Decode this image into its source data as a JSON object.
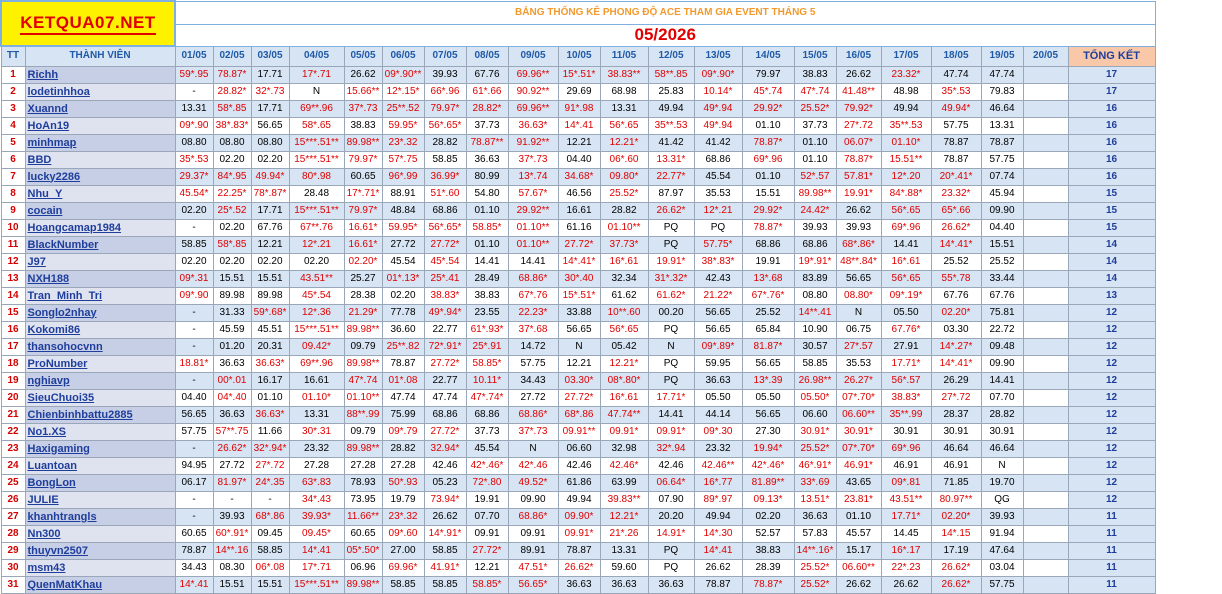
{
  "logo_text": "KETQUA07.NET",
  "title": "BẢNG THỐNG KÊ PHONG ĐỘ ACE THAM GIA EVENT THÁNG 5",
  "month": "05/2026",
  "headers": {
    "tt": "TT",
    "member": "THÀNH VIÊN",
    "total": "TỔNG KẾT",
    "dates": [
      "01/05",
      "02/05",
      "03/05",
      "04/05",
      "05/05",
      "06/05",
      "07/05",
      "08/05",
      "09/05",
      "10/05",
      "11/05",
      "12/05",
      "13/05",
      "14/05",
      "15/05",
      "16/05",
      "17/05",
      "18/05",
      "19/05",
      "20/05"
    ]
  },
  "colors": {
    "logo_bg": "#fff200",
    "red_text": "#e00000",
    "blue_text": "#1f3e9c",
    "row_tint": "#d6e4f3",
    "title_orange": "#f29a2e",
    "total_header_bg": "#f8c8a8"
  },
  "rows": [
    {
      "tt": "1",
      "name": "Richh",
      "total": "17",
      "cells": [
        "59*.95",
        "78.87*",
        "17.71",
        "17*.71",
        "26.62",
        "09*.90**",
        "39.93",
        "67.76",
        "69.96**",
        "15*.51*",
        "38.83**",
        "58**.85",
        "09*.90*",
        "79.97",
        "38.83",
        "26.62",
        "23.32*",
        "47.74",
        "47.74",
        ""
      ]
    },
    {
      "tt": "2",
      "name": "lodetinhhoa",
      "total": "17",
      "cells": [
        "-",
        "28.82*",
        "32*.73",
        "N",
        "15.66**",
        "12*.15*",
        "66*.96",
        "61*.66",
        "90.92**",
        "29.69",
        "68.98",
        "25.83",
        "10.14*",
        "45*.74",
        "47*.74",
        "41.48**",
        "48.98",
        "35*.53",
        "79.83",
        ""
      ]
    },
    {
      "tt": "3",
      "name": "Xuannd",
      "total": "16",
      "cells": [
        "13.31",
        "58*.85",
        "17.71",
        "69**.96",
        "37*.73",
        "25**.52",
        "79.97*",
        "28.82*",
        "69.96**",
        "91*.98",
        "13.31",
        "49.94",
        "49*.94",
        "29.92*",
        "25.52*",
        "79.92*",
        "49.94",
        "49.94*",
        "46.64",
        ""
      ]
    },
    {
      "tt": "4",
      "name": "HoAn19",
      "total": "16",
      "cells": [
        "09*.90",
        "38*.83*",
        "56.65",
        "58*.65",
        "38.83",
        "59.95*",
        "56*.65*",
        "37.73",
        "36.63*",
        "14*.41",
        "56*.65",
        "35**.53",
        "49*.94",
        "01.10",
        "37.73",
        "27*.72",
        "35**.53",
        "57.75",
        "13.31",
        ""
      ]
    },
    {
      "tt": "5",
      "name": "minhmap",
      "total": "16",
      "cells": [
        "08.80",
        "08.80",
        "08.80",
        "15***.51**",
        "89.98**",
        "23*.32",
        "28.82",
        "78.87**",
        "91.92**",
        "12.21",
        "12.21*",
        "41.42",
        "41.42",
        "78.87*",
        "01.10",
        "06.07*",
        "01.10*",
        "78.87",
        "78.87",
        ""
      ]
    },
    {
      "tt": "6",
      "name": "BBD",
      "total": "16",
      "cells": [
        "35*.53",
        "02.20",
        "02.20",
        "15***.51**",
        "79.97*",
        "57*.75",
        "58.85",
        "36.63",
        "37*.73",
        "04.40",
        "06*.60",
        "13.31*",
        "68.86",
        "69*.96",
        "01.10",
        "78.87*",
        "15.51**",
        "78.87",
        "57.75",
        ""
      ]
    },
    {
      "tt": "7",
      "name": "lucky2286",
      "total": "16",
      "cells": [
        "29.37*",
        "84*.95",
        "49.94*",
        "80*.98",
        "60.65",
        "96*.99",
        "36.99*",
        "80.99",
        "13*.74",
        "34.68*",
        "09.80*",
        "22.77*",
        "45.54",
        "01.10",
        "52*.57",
        "57.81*",
        "12*.20",
        "20*.41*",
        "07.74",
        ""
      ]
    },
    {
      "tt": "8",
      "name": "Nhu_Y",
      "total": "15",
      "cells": [
        "45.54*",
        "22.25*",
        "78*.87*",
        "28.48",
        "17*.71*",
        "88.91",
        "51*.60",
        "54.80",
        "57.67*",
        "46.56",
        "25.52*",
        "87.97",
        "35.53",
        "15.51",
        "89.98**",
        "19.91*",
        "84*.88*",
        "23.32*",
        "45.94",
        ""
      ]
    },
    {
      "tt": "9",
      "name": "cocain",
      "total": "15",
      "cells": [
        "02.20",
        "25*.52",
        "17.71",
        "15***.51**",
        "79.97*",
        "48.84",
        "68.86",
        "01.10",
        "29.92**",
        "16.61",
        "28.82",
        "26.62*",
        "12*.21",
        "29.92*",
        "24.42*",
        "26.62",
        "56*.65",
        "65*.66",
        "09.90",
        ""
      ]
    },
    {
      "tt": "10",
      "name": "Hoangcamap1984",
      "total": "15",
      "cells": [
        "-",
        "02.20",
        "67.76",
        "67**.76",
        "16.61*",
        "59.95*",
        "56*.65*",
        "58.85*",
        "01.10**",
        "61.16",
        "01.10**",
        "PQ",
        "PQ",
        "78.87*",
        "39.93",
        "39.93",
        "69*.96",
        "26.62*",
        "04.40",
        ""
      ]
    },
    {
      "tt": "11",
      "name": "BlackNumber",
      "total": "14",
      "cells": [
        "58.85",
        "58*.85",
        "12.21",
        "12*.21",
        "16.61*",
        "27.72",
        "27.72*",
        "01.10",
        "01.10**",
        "27.72*",
        "37.73*",
        "PQ",
        "57.75*",
        "68.86",
        "68.86",
        "68*.86*",
        "14.41",
        "14*.41*",
        "15.51",
        ""
      ]
    },
    {
      "tt": "12",
      "name": "J97",
      "total": "14",
      "cells": [
        "02.20",
        "02.20",
        "02.20",
        "02.20",
        "02.20*",
        "45.54",
        "45*.54",
        "14.41",
        "14.41",
        "14*.41*",
        "16*.61",
        "19.91*",
        "38*.83*",
        "19.91",
        "19*.91*",
        "48**.84*",
        "16*.61",
        "25.52",
        "25.52",
        ""
      ]
    },
    {
      "tt": "13",
      "name": "NXH188",
      "total": "14",
      "cells": [
        "09*.31",
        "15.51",
        "15.51",
        "43.51**",
        "25.27",
        "01*.13*",
        "25*.41",
        "28.49",
        "68.86*",
        "30*.40",
        "32.34",
        "31*.32*",
        "42.43",
        "13*.68",
        "83.89",
        "56.65",
        "56*.65",
        "55*.78",
        "33.44",
        ""
      ]
    },
    {
      "tt": "14",
      "name": "Tran_Minh_Tri",
      "total": "13",
      "cells": [
        "09*.90",
        "89.98",
        "89.98",
        "45*.54",
        "28.38",
        "02.20",
        "38.83*",
        "38.83",
        "67*.76",
        "15*.51*",
        "61.62",
        "61.62*",
        "21.22*",
        "67*.76*",
        "08.80",
        "08.80*",
        "09*.19*",
        "67.76",
        "67.76",
        ""
      ]
    },
    {
      "tt": "15",
      "name": "Songlo2nhay",
      "total": "12",
      "cells": [
        "-",
        "31.33",
        "59*.68*",
        "12*.36",
        "21.29*",
        "77.78",
        "49*.94*",
        "23.55",
        "22.23*",
        "33.88",
        "10**.60",
        "00.20",
        "56.65",
        "25.52",
        "14**.41",
        "N",
        "05.50",
        "02.20*",
        "75.81",
        ""
      ]
    },
    {
      "tt": "16",
      "name": "Kokomi86",
      "total": "12",
      "cells": [
        "-",
        "45.59",
        "45.51",
        "15***.51**",
        "89.98**",
        "36.60",
        "22.77",
        "61*.93*",
        "37*.68",
        "56.65",
        "56*.65",
        "PQ",
        "56.65",
        "65.84",
        "10.90",
        "06.75",
        "67.76*",
        "03.30",
        "22.72",
        ""
      ]
    },
    {
      "tt": "17",
      "name": "thansohocvnn",
      "total": "12",
      "cells": [
        "-",
        "01.20",
        "20.31",
        "09.42*",
        "09.79",
        "25**.82",
        "72*.91*",
        "25*.91",
        "14.72",
        "N",
        "05.42",
        "N",
        "09*.89*",
        "81.87*",
        "30.57",
        "27*.57",
        "27.91",
        "14*.27*",
        "09.48",
        ""
      ]
    },
    {
      "tt": "18",
      "name": "ProNumber",
      "total": "12",
      "cells": [
        "18.81*",
        "36.63",
        "36.63*",
        "69**.96",
        "89.98**",
        "78.87",
        "27.72*",
        "58.85*",
        "57.75",
        "12.21",
        "12.21*",
        "PQ",
        "59.95",
        "56.65",
        "58.85",
        "35.53",
        "17.71*",
        "14*.41*",
        "09.90",
        ""
      ]
    },
    {
      "tt": "19",
      "name": "nghiavp",
      "total": "12",
      "cells": [
        "-",
        "00*.01",
        "16.17",
        "16.61",
        "47*.74",
        "01*.08",
        "22.77",
        "10.11*",
        "34.43",
        "03.30*",
        "08*.80*",
        "PQ",
        "36.63",
        "13*.39",
        "26.98**",
        "26.27*",
        "56*.57",
        "26.29",
        "14.41",
        ""
      ]
    },
    {
      "tt": "20",
      "name": "SieuChuoi35",
      "total": "12",
      "cells": [
        "04.40",
        "04*.40",
        "01.10",
        "01.10*",
        "01.10**",
        "47.74",
        "47.74",
        "47*.74*",
        "27.72",
        "27.72*",
        "16*.61",
        "17.71*",
        "05.50",
        "05.50",
        "05.50*",
        "07*.70*",
        "38.83*",
        "27*.72",
        "07.70",
        ""
      ]
    },
    {
      "tt": "21",
      "name": "Chienbinhbattu2885",
      "total": "12",
      "cells": [
        "56.65",
        "36.63",
        "36.63*",
        "13.31",
        "88**.99",
        "75.99",
        "68.86",
        "68.86",
        "68.86*",
        "68*.86",
        "47.74**",
        "14.41",
        "44.14",
        "56.65",
        "06.60",
        "06.60**",
        "35**.99",
        "28.37",
        "28.82",
        ""
      ]
    },
    {
      "tt": "22",
      "name": "No1.XS",
      "total": "12",
      "cells": [
        "57.75",
        "57**.75",
        "11.66",
        "30*.31",
        "09.79",
        "09*.79",
        "27.72*",
        "37.73",
        "37*.73",
        "09.91**",
        "09.91*",
        "09.91*",
        "09*.30",
        "27.30",
        "30.91*",
        "30.91*",
        "30.91",
        "30.91",
        "30.91",
        ""
      ]
    },
    {
      "tt": "23",
      "name": "Haxigaming",
      "total": "12",
      "cells": [
        "-",
        "26.62*",
        "32*.94*",
        "23.32",
        "89.98**",
        "28.82",
        "32.94*",
        "45.54",
        "N",
        "06.60",
        "32.98",
        "32*.94",
        "23.32",
        "19.94*",
        "25.52*",
        "07*.70*",
        "69*.96",
        "46.64",
        "46.64",
        ""
      ]
    },
    {
      "tt": "24",
      "name": "Luantoan",
      "total": "12",
      "cells": [
        "94.95",
        "27.72",
        "27*.72",
        "27.28",
        "27.28",
        "27.28",
        "42.46",
        "42*.46*",
        "42*.46",
        "42.46",
        "42.46*",
        "42.46",
        "42.46**",
        "42*.46*",
        "46*.91*",
        "46.91*",
        "46.91",
        "46.91",
        "N",
        ""
      ]
    },
    {
      "tt": "25",
      "name": "BongLon",
      "total": "12",
      "cells": [
        "06.17",
        "81.97*",
        "24*.35",
        "63*.83",
        "78.93",
        "50*.93",
        "05.23",
        "72*.80",
        "49.52*",
        "61.86",
        "63.99",
        "06.64*",
        "16*.77",
        "81.89**",
        "33*.69",
        "43.65",
        "09*.81",
        "71.85",
        "19.70",
        ""
      ]
    },
    {
      "tt": "26",
      "name": "JULIE",
      "total": "12",
      "cells": [
        "-",
        "-",
        "-",
        "34*.43",
        "73.95",
        "19.79",
        "73.94*",
        "19.91",
        "09.90",
        "49.94",
        "39.83**",
        "07.90",
        "89*.97",
        "09.13*",
        "13.51*",
        "23.81*",
        "43.51**",
        "80.97**",
        "QG",
        ""
      ]
    },
    {
      "tt": "27",
      "name": "khanhtrangls",
      "total": "11",
      "cells": [
        "-",
        "39.93",
        "68*.86",
        "39.93*",
        "11.66**",
        "23*.32",
        "26.62",
        "07.70",
        "68.86*",
        "09.90*",
        "12.21*",
        "20.20",
        "49.94",
        "02.20",
        "36.63",
        "01.10",
        "17.71*",
        "02.20*",
        "39.93",
        ""
      ]
    },
    {
      "tt": "28",
      "name": "Nn300",
      "total": "11",
      "cells": [
        "60.65",
        "60*.91*",
        "09.45",
        "09.45*",
        "60.65",
        "09*.60",
        "14*.91*",
        "09.91",
        "09.91",
        "09.91*",
        "21*.26",
        "14.91*",
        "14*.30",
        "52.57",
        "57.83",
        "45.57",
        "14.45",
        "14*.15",
        "91.94",
        ""
      ]
    },
    {
      "tt": "29",
      "name": "thuyvn2507",
      "total": "11",
      "cells": [
        "78.87",
        "14**.16",
        "58.85",
        "14*.41",
        "05*.50*",
        "27.00",
        "58.85",
        "27.72*",
        "89.91",
        "78.87",
        "13.31",
        "PQ",
        "14*.41",
        "38.83",
        "14**.16*",
        "15.17",
        "16*.17",
        "17.19",
        "47.64",
        ""
      ]
    },
    {
      "tt": "30",
      "name": "msm43",
      "total": "11",
      "cells": [
        "34.43",
        "08.30",
        "06*.08",
        "17*.71",
        "06.96",
        "69.96*",
        "41.91*",
        "12.21",
        "47.51*",
        "26.62*",
        "59.60",
        "PQ",
        "26.62",
        "28.39",
        "25.52*",
        "06.60**",
        "22*.23",
        "26.62*",
        "03.04",
        ""
      ]
    },
    {
      "tt": "31",
      "name": "QuenMatKhau",
      "total": "11",
      "cells": [
        "14*.41",
        "15.51",
        "15.51",
        "15***.51**",
        "89.98**",
        "58.85",
        "58.85",
        "58.85*",
        "56.65*",
        "36.63",
        "36.63",
        "36.63",
        "78.87",
        "78.87*",
        "25.52*",
        "26.62",
        "26.62",
        "26.62*",
        "57.75",
        ""
      ]
    }
  ]
}
